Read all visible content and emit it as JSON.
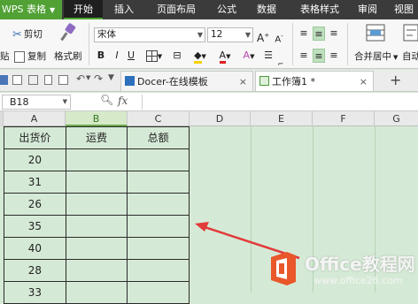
{
  "app": {
    "title": "WPS 表格"
  },
  "ribbon_tabs": [
    "开始",
    "插入",
    "页面布局",
    "公式",
    "数据",
    "表格样式",
    "审阅",
    "视图"
  ],
  "clipboard": {
    "cut": "剪切",
    "copy": "复制",
    "format_painter": "格式刷",
    "paste_fragment": "贴"
  },
  "font": {
    "name": "宋体",
    "size": "12"
  },
  "format_buttons": {
    "bold": "B",
    "italic": "I",
    "underline": "U"
  },
  "alignment": {
    "merge_center": "合并居中",
    "auto_wrap": "自动"
  },
  "doc_tabs": [
    {
      "label": "Docer-在线模板",
      "close": "×"
    },
    {
      "label": "工作簿1 *",
      "close": "×"
    }
  ],
  "new_tab": "+",
  "formula_bar": {
    "name_box": "B18",
    "fx": "fx"
  },
  "columns": [
    "A",
    "B",
    "C",
    "D",
    "E",
    "F",
    "G"
  ],
  "table": {
    "headers": [
      "出货价",
      "运费",
      "总额"
    ],
    "rows": [
      [
        "20",
        "",
        ""
      ],
      [
        "31",
        "",
        ""
      ],
      [
        "26",
        "",
        ""
      ],
      [
        "35",
        "",
        ""
      ],
      [
        "40",
        "",
        ""
      ],
      [
        "28",
        "",
        ""
      ],
      [
        "33",
        "",
        ""
      ]
    ]
  },
  "watermark": {
    "brand": "Office教程网",
    "url": "www.office26.com"
  },
  "colors": {
    "accent": "#51a135",
    "grid_bg": "#d5ead6",
    "arrow": "#e23b3b",
    "logo": "#e9572a"
  }
}
